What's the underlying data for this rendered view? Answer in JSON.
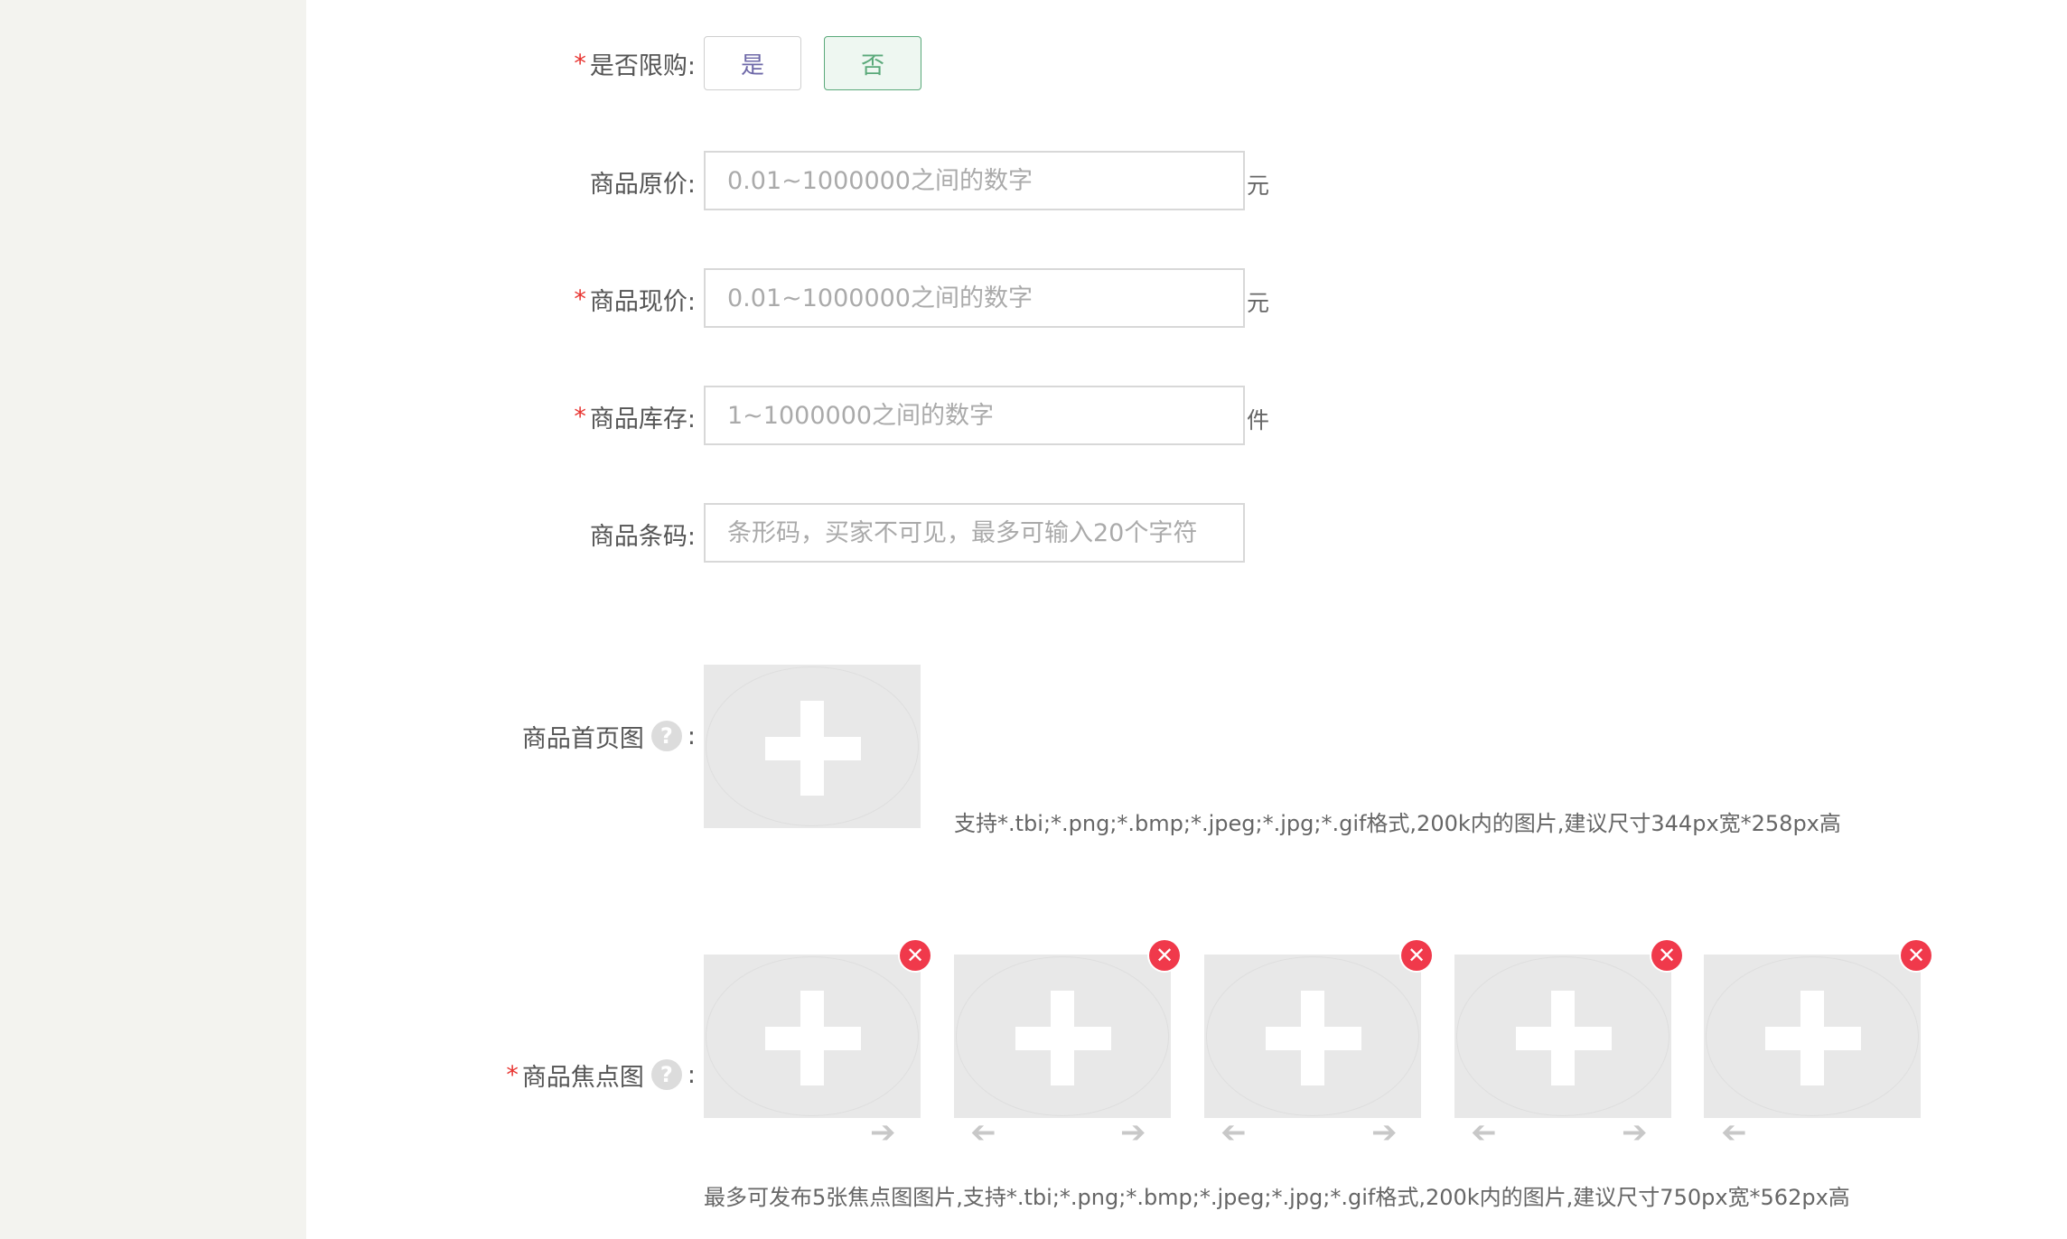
{
  "limit": {
    "label": "是否限购:",
    "required": "*",
    "options": [
      "是",
      "否"
    ],
    "selected": "否"
  },
  "original_price": {
    "label": "商品原价:",
    "placeholder": "0.01~1000000之间的数字",
    "unit": "元"
  },
  "current_price": {
    "label": "商品现价:",
    "required": "*",
    "placeholder": "0.01~1000000之间的数字",
    "unit": "元"
  },
  "stock": {
    "label": "商品库存:",
    "required": "*",
    "placeholder": "1~1000000之间的数字",
    "unit": "件"
  },
  "barcode": {
    "label": "商品条码:",
    "placeholder": "条形码，买家不可见，最多可输入20个字符"
  },
  "home_image": {
    "label": "商品首页图",
    "colon": ":",
    "help": "?",
    "hint": "支持*.tbi;*.png;*.bmp;*.jpeg;*.jpg;*.gif格式,200k内的图片,建议尺寸344px宽*258px高"
  },
  "focus_images": {
    "label": "商品焦点图",
    "required": "*",
    "colon": ":",
    "help": "?",
    "delete_glyph": "✕",
    "hint": "最多可发布5张焦点图图片,支持*.tbi;*.png;*.bmp;*.jpeg;*.jpg;*.gif格式,200k内的图片,建议尺寸750px宽*562px高"
  },
  "colors": {
    "required": "#e8332f",
    "selected": "#5aa97a",
    "delete": "#f0394b"
  }
}
